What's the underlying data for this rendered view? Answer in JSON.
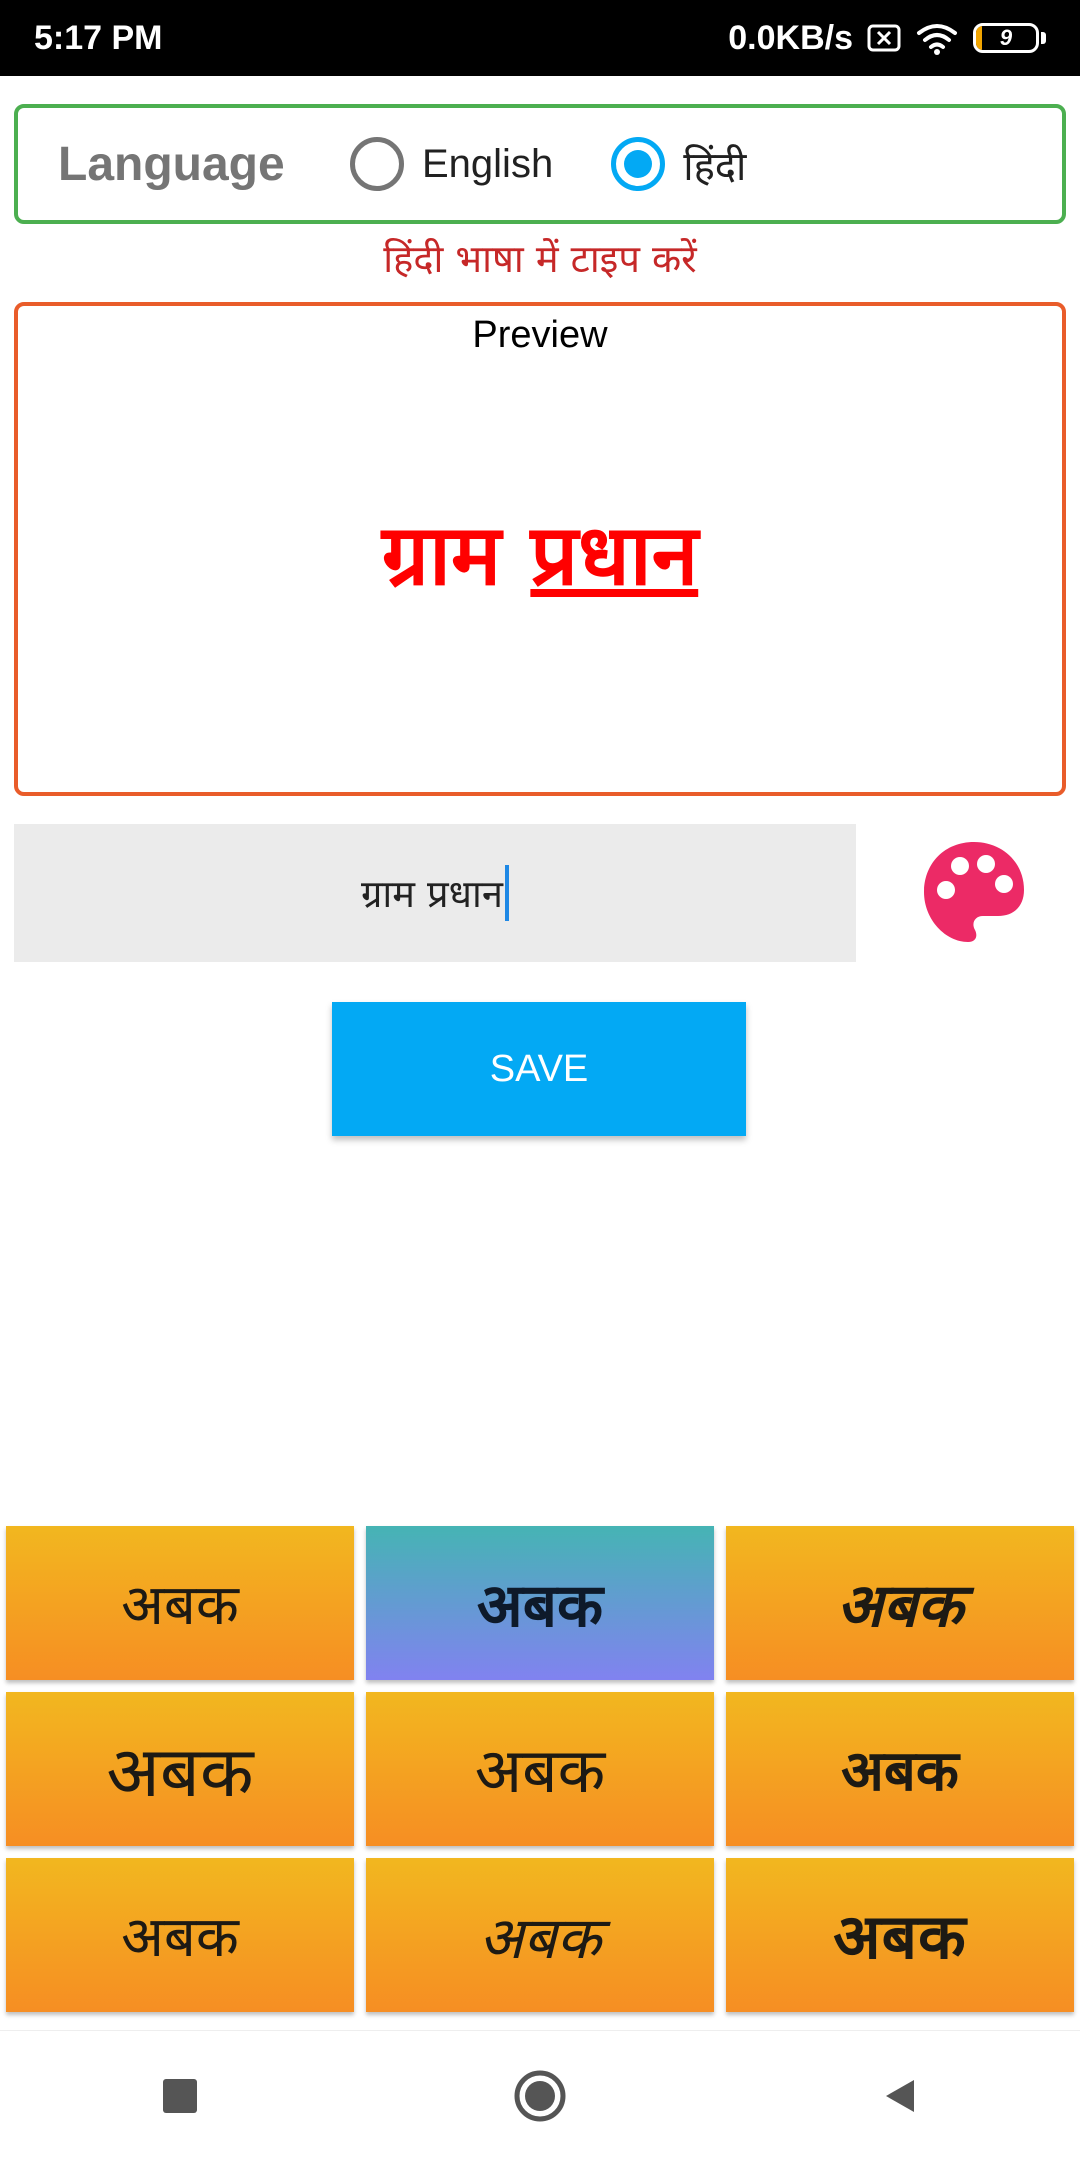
{
  "status_bar": {
    "time": "5:17 PM",
    "net_speed": "0.0KB/s",
    "battery_level": "9"
  },
  "language": {
    "title": "Language",
    "options": [
      {
        "label": "English",
        "selected": false
      },
      {
        "label": "हिंदी",
        "selected": true
      }
    ]
  },
  "hint": "हिंदी भाषा में टाइप करें",
  "preview": {
    "title": "Preview",
    "text_part1": "ग्राम ",
    "text_part2": "प्रधान",
    "color": "#ff0000"
  },
  "input": {
    "value": "ग्राम प्रधान"
  },
  "icons": {
    "palette": "palette-icon",
    "recents": "square-icon",
    "home": "circle-icon",
    "back": "triangle-back-icon"
  },
  "save_label": "SAVE",
  "font_styles": [
    "अबक",
    "अबक",
    "अबक",
    "अबक",
    "अबक",
    "अबक",
    "अबक",
    "अबक",
    "अबक"
  ],
  "colors": {
    "accent": "#03a9f4",
    "palette": "#ec2a66",
    "tile_gradient_top": "#f2b71f",
    "tile_gradient_bottom": "#f68e23"
  }
}
